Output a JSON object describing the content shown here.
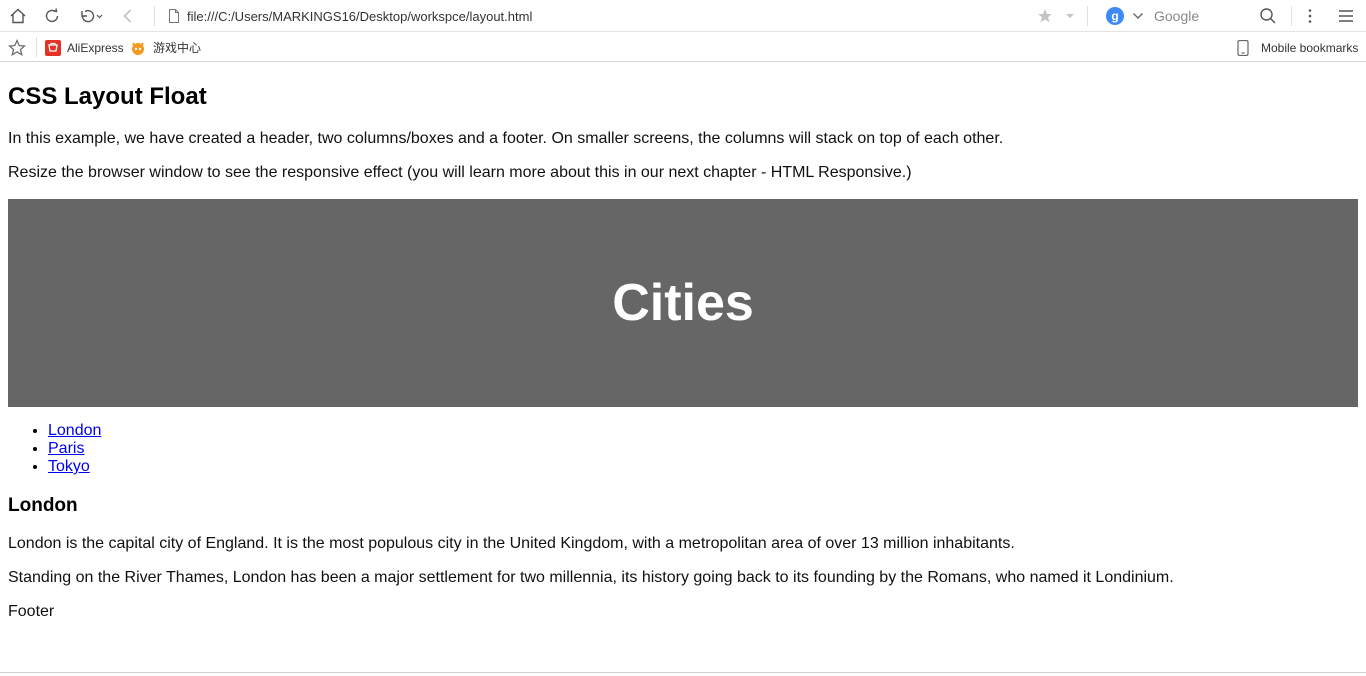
{
  "browser": {
    "address_url": "file:///C:/Users/MARKINGS16/Desktop/workspce/layout.html",
    "search_engine": "Google",
    "search_engine_badge": "g",
    "bookmarks": [
      {
        "label": "AliExpress",
        "icon": "aliexpress-icon",
        "color": "#e43225"
      },
      {
        "label": "游戏中心",
        "icon": "game-center-icon",
        "color": "#f39a1e"
      }
    ],
    "mobile_bookmarks_label": "Mobile bookmarks"
  },
  "page": {
    "title": "CSS Layout Float",
    "intro_1": "In this example, we have created a header, two columns/boxes and a footer. On smaller screens, the columns will stack on top of each other.",
    "intro_2": "Resize the browser window to see the responsive effect (you will learn more about this in our next chapter - HTML Responsive.)",
    "header_title": "Cities",
    "header_bg": "#666666",
    "nav_links": [
      "London",
      "Paris",
      "Tokyo"
    ],
    "article_title": "London",
    "article_p1": "London is the capital city of England. It is the most populous city in the United Kingdom, with a metropolitan area of over 13 million inhabitants.",
    "article_p2": "Standing on the River Thames, London has been a major settlement for two millennia, its history going back to its founding by the Romans, who named it Londinium.",
    "footer": "Footer",
    "link_color": "#0000ee"
  }
}
